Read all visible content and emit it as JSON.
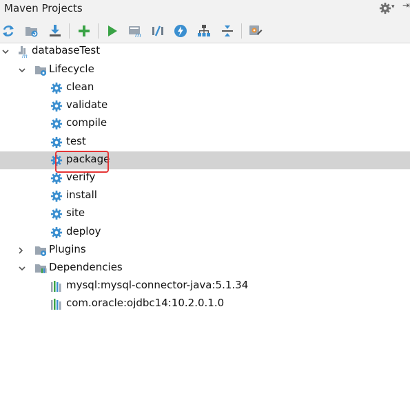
{
  "panel": {
    "title": "Maven Projects"
  },
  "toolbar": {
    "buttons": [
      {
        "icon": "reimport-icon"
      },
      {
        "icon": "generate-sources-icon"
      },
      {
        "icon": "download-icon"
      },
      {
        "icon": "add-icon"
      },
      {
        "icon": "run-icon"
      },
      {
        "icon": "execute-goal-icon"
      },
      {
        "icon": "toggle-offline-icon"
      },
      {
        "icon": "skip-tests-icon"
      },
      {
        "icon": "show-dependencies-icon"
      },
      {
        "icon": "collapse-all-icon"
      },
      {
        "icon": "maven-settings-icon"
      }
    ]
  },
  "tree": {
    "project": "databaseTest",
    "lifecycle": {
      "label": "Lifecycle",
      "goals": [
        "clean",
        "validate",
        "compile",
        "test",
        "package",
        "verify",
        "install",
        "site",
        "deploy"
      ]
    },
    "plugins": {
      "label": "Plugins"
    },
    "dependencies": {
      "label": "Dependencies",
      "items": [
        "mysql:mysql-connector-java:5.1.34",
        "com.oracle:ojdbc14:10.2.0.1.0"
      ]
    },
    "selected": "package"
  },
  "colors": {
    "accent_blue": "#3b8fd0",
    "run_green": "#3aa346",
    "selection": "#d3d3d3",
    "highlight_red": "#e53535"
  }
}
